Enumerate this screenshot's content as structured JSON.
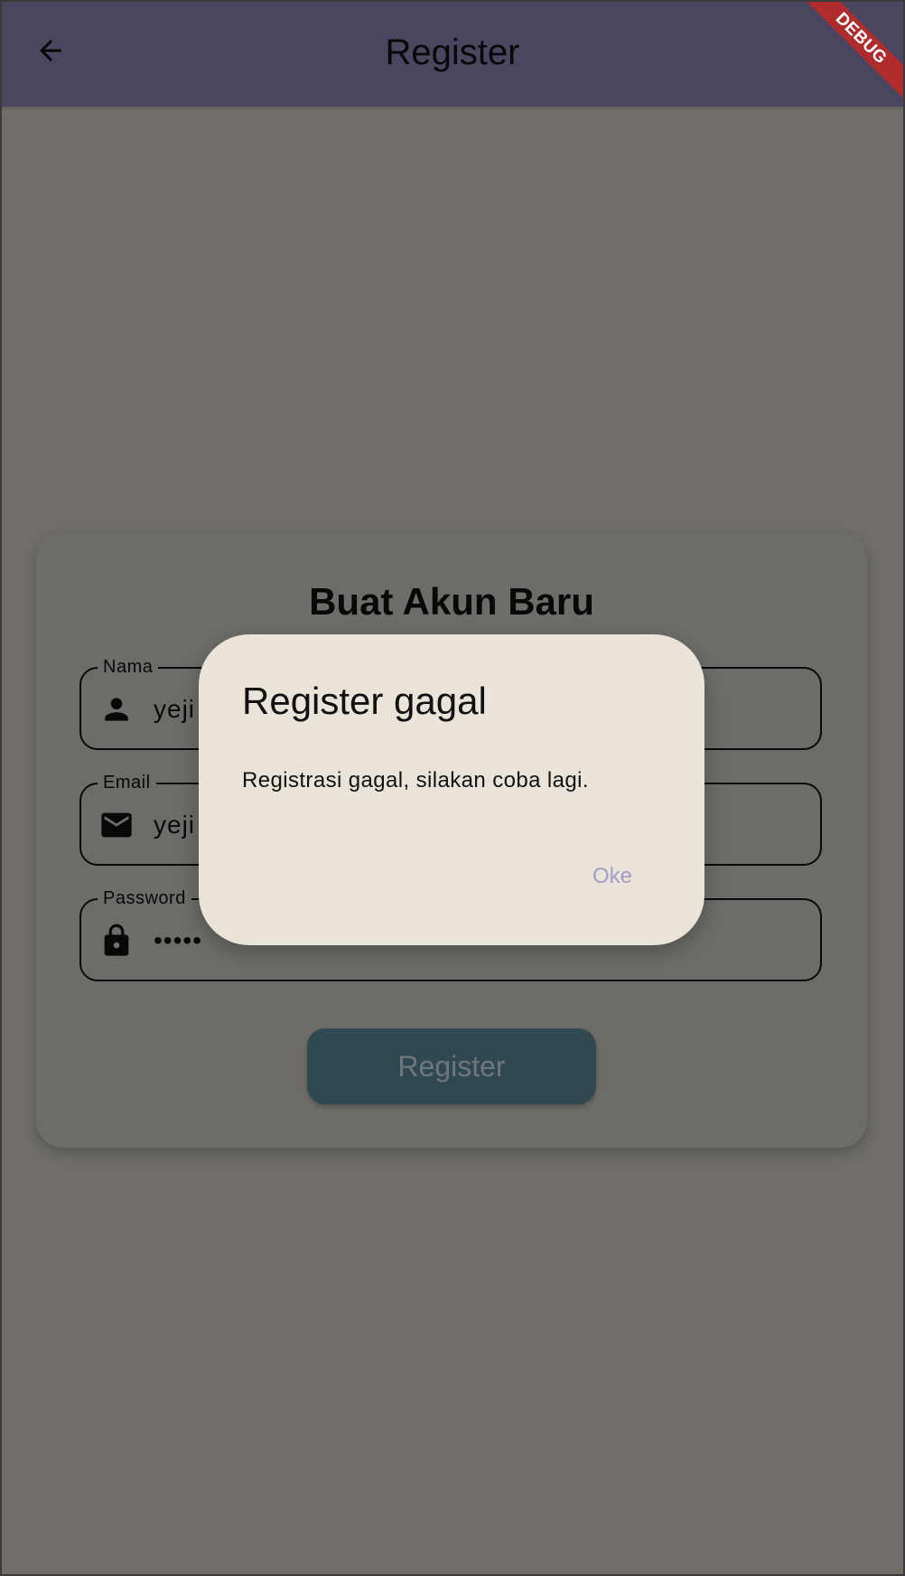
{
  "appbar": {
    "title": "Register",
    "back_icon": "arrow-back-icon",
    "debug_banner": "DEBUG"
  },
  "form": {
    "title": "Buat Akun Baru",
    "fields": [
      {
        "label": "Nama",
        "value": "yeji",
        "icon": "person-icon"
      },
      {
        "label": "Email",
        "value": "yeji",
        "icon": "mail-icon"
      },
      {
        "label": "Password",
        "value": "•••••",
        "icon": "lock-icon"
      }
    ],
    "submit_label": "Register"
  },
  "dialog": {
    "title": "Register gagal",
    "message": "Registrasi gagal, silakan coba lagi.",
    "ok_label": "Oke"
  },
  "colors": {
    "appbar": "#8f86b8",
    "background": "#d9d4cc",
    "button": "#5c8a9a",
    "dialog": "#e9e3d9",
    "dialog_action": "#a49bc8",
    "debug_banner": "#b02c2c"
  }
}
